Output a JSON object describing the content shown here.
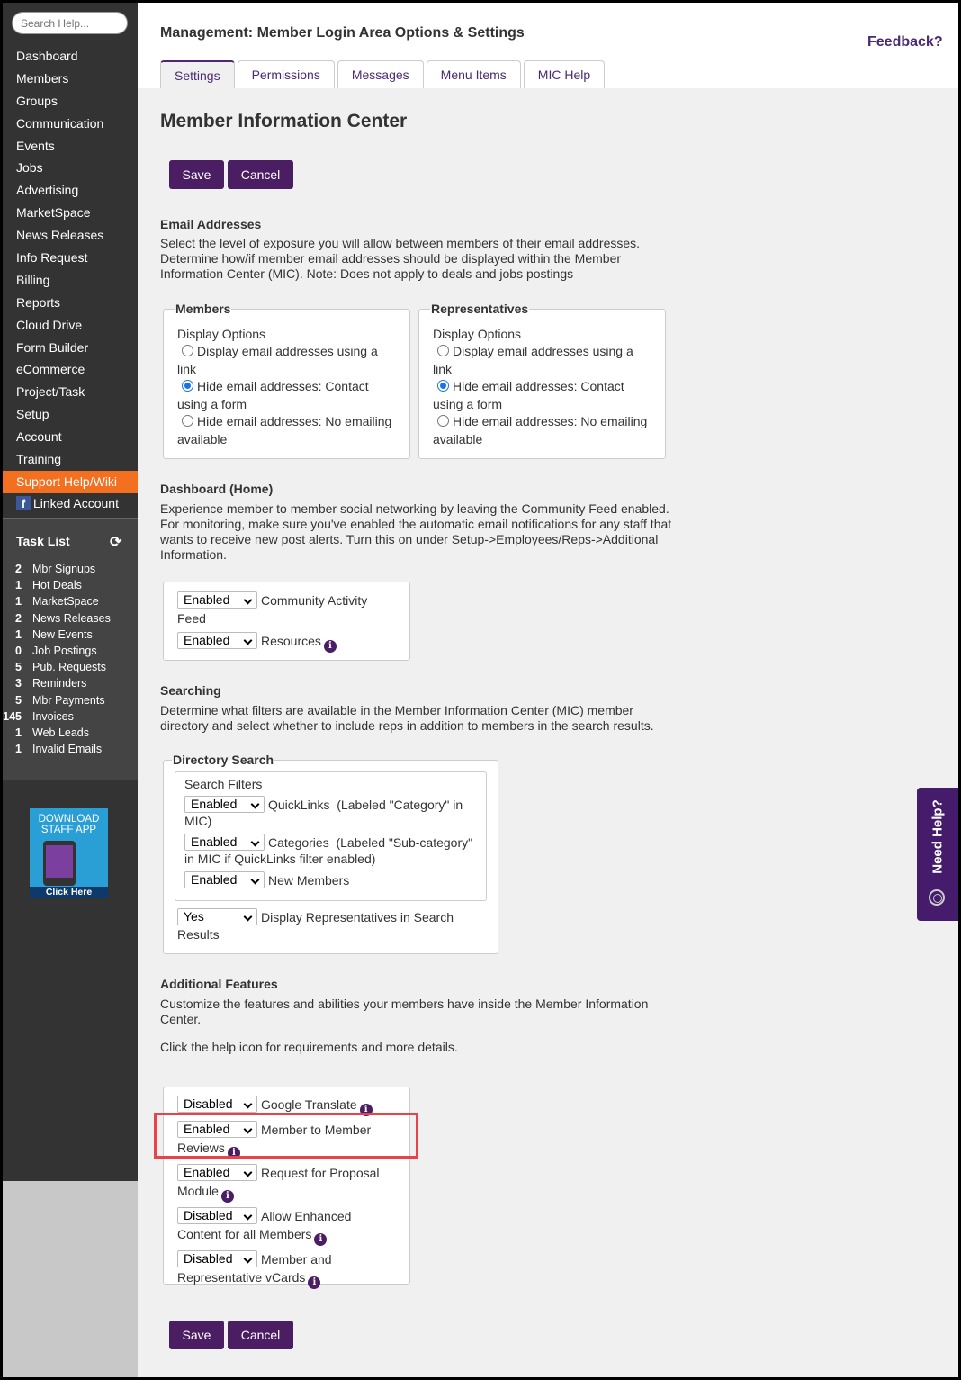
{
  "sidebar": {
    "search_placeholder": "Search Help...",
    "items": [
      "Dashboard",
      "Members",
      "Groups",
      "Communication",
      "Events",
      "Jobs",
      "Advertising",
      "MarketSpace",
      "News Releases",
      "Info Request",
      "Billing",
      "Reports",
      "Cloud Drive",
      "Form Builder",
      "eCommerce",
      "Project/Task",
      "Setup",
      "Account",
      "Training",
      "Support Help/Wiki"
    ],
    "linked_account": "Linked Account",
    "task_list_title": "Task List",
    "tasks": [
      {
        "count": "2",
        "label": "Mbr Signups"
      },
      {
        "count": "1",
        "label": "Hot Deals"
      },
      {
        "count": "1",
        "label": "MarketSpace"
      },
      {
        "count": "2",
        "label": "News Releases"
      },
      {
        "count": "1",
        "label": "New Events"
      },
      {
        "count": "0",
        "label": "Job Postings"
      },
      {
        "count": "5",
        "label": "Pub. Requests"
      },
      {
        "count": "3",
        "label": "Reminders"
      },
      {
        "count": "5",
        "label": "Mbr Payments"
      },
      {
        "count": "145",
        "label": "Invoices"
      },
      {
        "count": "1",
        "label": "Web Leads"
      },
      {
        "count": "1",
        "label": "Invalid Emails"
      }
    ],
    "app_banner": {
      "line1": "DOWNLOAD",
      "line2": "STAFF APP",
      "cta": "Click Here"
    }
  },
  "header": {
    "title": "Management: Member Login Area Options & Settings",
    "feedback": "Feedback?",
    "tabs": [
      "Settings",
      "Permissions",
      "Messages",
      "Menu Items",
      "MIC Help"
    ]
  },
  "main": {
    "heading": "Member Information Center",
    "save": "Save",
    "cancel": "Cancel",
    "email": {
      "heading": "Email Addresses",
      "text": "Select the level of exposure you will allow between members of their email addresses. Determine how/if member email addresses should be displayed within the Member Information Center (MIC). Note: Does not apply to deals and jobs postings",
      "members_legend": "Members",
      "reps_legend": "Representatives",
      "display_options": "Display Options",
      "options": [
        "Display email addresses using a link",
        "Hide email addresses: Contact using a form",
        "Hide email addresses: No emailing available"
      ],
      "members_selected": 1,
      "reps_selected": 1
    },
    "dashboard": {
      "heading": "Dashboard (Home)",
      "text": "Experience member to member social networking by leaving the Community Feed enabled. For monitoring, make sure you've enabled the automatic email notifications for any staff that wants to receive new post alerts. Turn this on under Setup->Employees/Reps->Additional Information.",
      "rows": [
        {
          "value": "Enabled",
          "label": "Community Activity Feed"
        },
        {
          "value": "Enabled",
          "label": "Resources"
        }
      ]
    },
    "searching": {
      "heading": "Searching",
      "text": "Determine what filters are available in the Member Information Center (MIC) member directory and select whether to include reps in addition to members in the search results.",
      "legend": "Directory Search",
      "filters_title": "Search Filters",
      "filters": [
        {
          "value": "Enabled",
          "label": "QuickLinks",
          "note": "(Labeled \"Category\" in MIC)"
        },
        {
          "value": "Enabled",
          "label": "Categories",
          "note": "(Labeled \"Sub-category\" in MIC if QuickLinks filter enabled)"
        },
        {
          "value": "Enabled",
          "label": "New Members"
        }
      ],
      "reps": {
        "value": "Yes",
        "label": "Display Representatives in Search Results"
      }
    },
    "additional": {
      "heading": "Additional Features",
      "text": "Customize the features and abilities your members have inside the Member Information Center.",
      "text2": "Click the help icon for requirements and more details.",
      "rows": [
        {
          "value": "Disabled",
          "label": "Google Translate"
        },
        {
          "value": "Enabled",
          "label": "Member to Member Reviews"
        },
        {
          "value": "Enabled",
          "label": "Request for Proposal Module"
        },
        {
          "value": "Disabled",
          "label": "Allow Enhanced Content for all Members"
        },
        {
          "value": "Disabled",
          "label": "Member and Representative vCards"
        }
      ]
    }
  },
  "need_help": "Need Help?",
  "colors": {
    "accent": "#4b1d63",
    "active_nav": "#f37021",
    "highlight": "#e8424a"
  }
}
